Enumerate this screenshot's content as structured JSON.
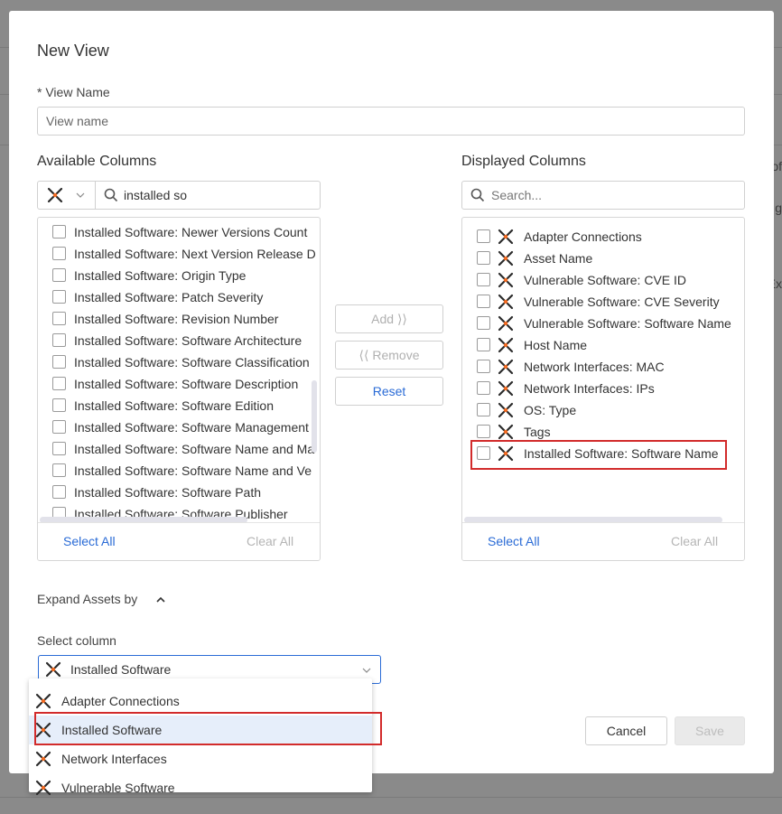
{
  "background": {
    "fragments": [
      "of",
      "g",
      "Ex"
    ]
  },
  "dialog": {
    "title": "New View",
    "view_name_label": "* View Name",
    "view_name_placeholder": "View name"
  },
  "available": {
    "title": "Available Columns",
    "search_value": "installed so",
    "items": [
      "Installed Software: Newer Versions Count",
      "Installed Software: Next Version Release D",
      "Installed Software: Origin Type",
      "Installed Software: Patch Severity",
      "Installed Software: Revision Number",
      "Installed Software: Software Architecture",
      "Installed Software: Software Classification",
      "Installed Software: Software Description",
      "Installed Software: Software Edition",
      "Installed Software: Software Management",
      "Installed Software: Software Name and Ma",
      "Installed Software: Software Name and Ve",
      "Installed Software: Software Path",
      "Installed Software: Software Publisher"
    ],
    "select_all": "Select All",
    "clear_all": "Clear All"
  },
  "actions": {
    "add": "Add",
    "remove": "Remove",
    "reset": "Reset"
  },
  "displayed": {
    "title": "Displayed Columns",
    "search_placeholder": "Search...",
    "items": [
      "Adapter Connections",
      "Asset Name",
      "Vulnerable Software: CVE ID",
      "Vulnerable Software: CVE Severity",
      "Vulnerable Software: Software Name",
      "Host Name",
      "Network Interfaces: MAC",
      "Network Interfaces: IPs",
      "OS: Type",
      "Tags",
      "Installed Software: Software Name"
    ],
    "select_all": "Select All",
    "clear_all": "Clear All"
  },
  "expand": {
    "label": "Expand Assets by",
    "select_label": "Select column",
    "selected": "Installed Software",
    "options": [
      "Adapter Connections",
      "Installed Software",
      "Network Interfaces",
      "Vulnerable Software"
    ]
  },
  "footer": {
    "cancel": "Cancel",
    "save": "Save"
  },
  "colors": {
    "accent": "#2a6bd6",
    "highlight": "#d22b2b",
    "icon_dark": "#2b2b2b",
    "icon_orange": "#f26a21"
  },
  "icons": {
    "adapter": "axonius-adapter-icon",
    "search": "search-icon",
    "chevron": "chevron-down-icon"
  }
}
